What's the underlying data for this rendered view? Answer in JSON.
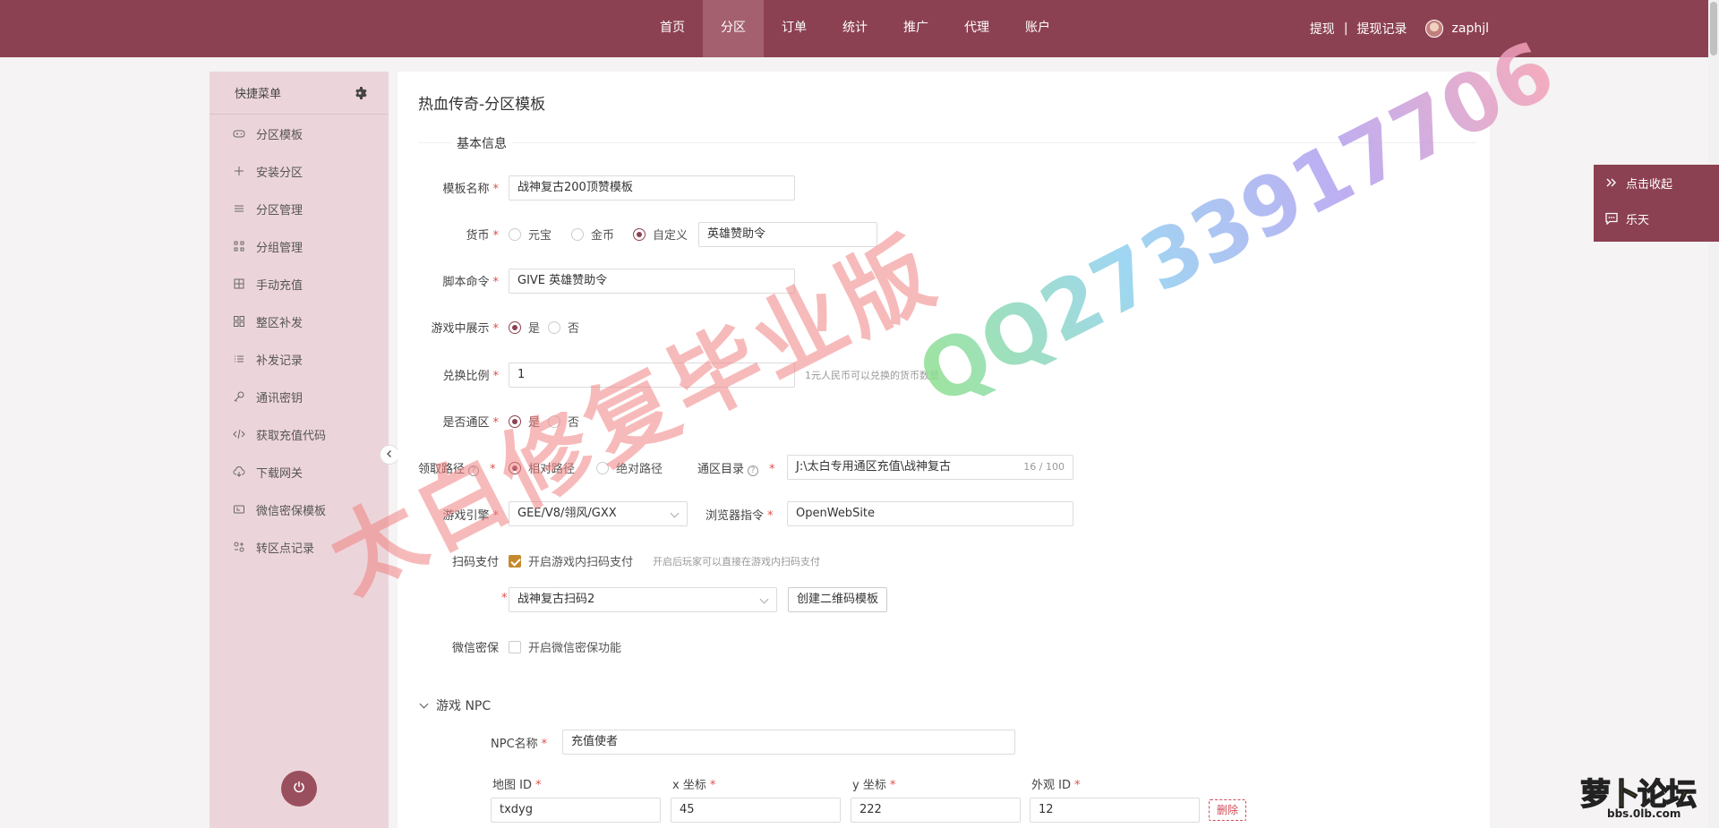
{
  "topnav": {
    "items": [
      "首页",
      "分区",
      "订单",
      "统计",
      "推广",
      "代理",
      "账户"
    ],
    "active_index": 1
  },
  "topright": {
    "withdraw": "提现",
    "separator": "|",
    "withdraw_records": "提现记录",
    "username": "zaphjl"
  },
  "sidebar": {
    "title": "快捷菜单",
    "items": [
      {
        "label": "分区模板",
        "icon": "gamepad-icon"
      },
      {
        "label": "安装分区",
        "icon": "plus-icon"
      },
      {
        "label": "分区管理",
        "icon": "menu-icon"
      },
      {
        "label": "分组管理",
        "icon": "group-icon"
      },
      {
        "label": "手动充值",
        "icon": "grid-icon"
      },
      {
        "label": "整区补发",
        "icon": "apps-icon"
      },
      {
        "label": "补发记录",
        "icon": "list-icon"
      },
      {
        "label": "通讯密钥",
        "icon": "key-icon"
      },
      {
        "label": "获取充值代码",
        "icon": "code-icon"
      },
      {
        "label": "下载网关",
        "icon": "cloud-download-icon"
      },
      {
        "label": "微信密保模板",
        "icon": "card-icon"
      },
      {
        "label": "转区点记录",
        "icon": "transfer-icon"
      }
    ]
  },
  "page": {
    "title": "热血传奇-分区模板",
    "section": "基本信息"
  },
  "form": {
    "template_name": {
      "label": "模板名称",
      "value": "战神复古200顶赞模板"
    },
    "currency": {
      "label": "货币",
      "options": [
        "元宝",
        "金币",
        "自定义"
      ],
      "selected": "自定义",
      "custom_value": "英雄赞助令"
    },
    "script_command": {
      "label": "脚本命令",
      "value": "GIVE 英雄赞助令"
    },
    "show_in_game": {
      "label": "游戏中展示",
      "yes": "是",
      "no": "否",
      "selected": "是"
    },
    "exchange_ratio": {
      "label": "兑换比例",
      "value": "1",
      "hint": "1元人民币可以兑换的货币数量"
    },
    "universal_zone": {
      "label": "是否通区",
      "yes": "是",
      "no": "否",
      "selected": "是"
    },
    "path": {
      "label": "领取路径",
      "relative": "相对路径",
      "absolute": "绝对路径",
      "selected": "相对路径"
    },
    "universal_dir": {
      "label": "通区目录",
      "value": "J:\\太白专用通区充值\\战神复古",
      "counter": "16 / 100"
    },
    "engine": {
      "label": "游戏引擎",
      "value": "GEE/V8/翎风/GXX"
    },
    "browser_cmd": {
      "label": "浏览器指令",
      "value": "OpenWebSite"
    },
    "scan_pay": {
      "label": "扫码支付",
      "checkbox_label": "开启游戏内扫码支付",
      "checked": true,
      "hint": "开启后玩家可以直接在游戏内扫码支付"
    },
    "qr_template": {
      "value": "战神复古扫码2",
      "create_button": "创建二维码模板"
    },
    "wechat_security": {
      "label": "微信密保",
      "checkbox_label": "开启微信密保功能",
      "checked": false
    }
  },
  "npc": {
    "section": "游戏 NPC",
    "name_label": "NPC名称",
    "name_value": "充值使者",
    "columns": [
      "地图 ID",
      "x 坐标",
      "y 坐标",
      "外观 ID"
    ],
    "row": [
      "txdyg",
      "45",
      "222",
      "12"
    ],
    "delete_button": "删除"
  },
  "float_panel": {
    "collapse": "点击收起",
    "chat": "乐天"
  },
  "watermarks": {
    "left": "太白修复毕业版",
    "right": "QQ2733917706"
  },
  "corner_logo": {
    "big": "萝卜论坛",
    "small": "bbs.0lb.com"
  },
  "colors": {
    "brand": "#8c4152",
    "sidebar_bg": "#ecd5da",
    "required": "#e04f4f",
    "checkbox": "#c58a2c"
  }
}
